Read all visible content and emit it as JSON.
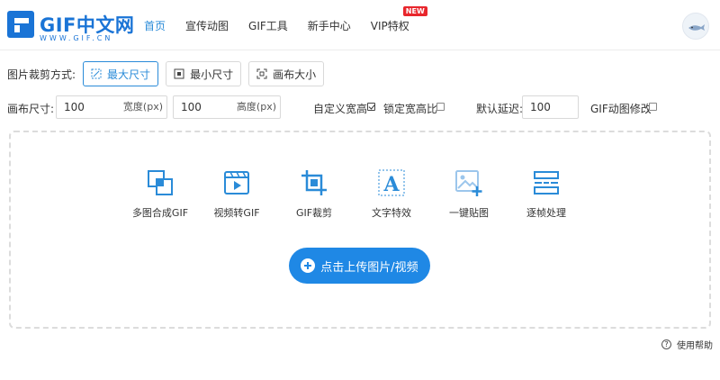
{
  "brand": {
    "logo_text": "GIF中文网",
    "logo_sub": "WWW.GIF.CN"
  },
  "nav": {
    "items": [
      {
        "label": "首页",
        "active": true
      },
      {
        "label": "宣传动图",
        "active": false
      },
      {
        "label": "GIF工具",
        "active": false
      },
      {
        "label": "新手中心",
        "active": false
      },
      {
        "label": "VIP特权",
        "active": false,
        "badge": "NEW"
      }
    ]
  },
  "crop": {
    "label": "图片裁剪方式:",
    "modes": [
      {
        "label": "最大尺寸",
        "active": true,
        "icon": "max-size-icon"
      },
      {
        "label": "最小尺寸",
        "active": false,
        "icon": "min-size-icon"
      },
      {
        "label": "画布大小",
        "active": false,
        "icon": "canvas-size-icon"
      }
    ]
  },
  "canvas": {
    "label": "画布尺寸:",
    "width_value": "100",
    "width_unit": "宽度(px)",
    "height_value": "100",
    "height_unit": "高度(px)",
    "custom_ratio_label": "自定义宽高",
    "custom_ratio_checked": true,
    "lock_ratio_label": "锁定宽高比",
    "lock_ratio_checked": false,
    "delay_label": "默认延迟:",
    "delay_value": "100",
    "gif_edit_label": "GIF动图修改",
    "gif_edit_checked": false
  },
  "tools": [
    {
      "label": "多图合成GIF",
      "icon": "merge-images-icon"
    },
    {
      "label": "视频转GIF",
      "icon": "video-icon"
    },
    {
      "label": "GIF裁剪",
      "icon": "crop-icon"
    },
    {
      "label": "文字特效",
      "icon": "text-icon"
    },
    {
      "label": "一键贴图",
      "icon": "add-image-icon"
    },
    {
      "label": "逐帧处理",
      "icon": "frames-icon"
    }
  ],
  "upload": {
    "label": "点击上传图片/视频"
  },
  "help": {
    "label": "使用帮助"
  },
  "colors": {
    "accent": "#1f88e5",
    "icon": "#2a8bd8",
    "badge": "#e8262c"
  }
}
